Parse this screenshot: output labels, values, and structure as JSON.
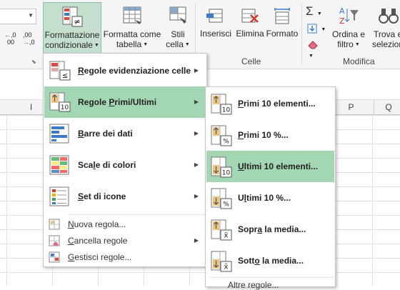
{
  "ribbon": {
    "number_format_value": "",
    "decimals_increase_label": ",0",
    "decimals_increase_sub": "00",
    "decimals_decrease_label": ",00",
    "decimals_decrease_sub": ",0",
    "conditional_formatting": {
      "line1": "Formattazione",
      "line2": "condizionale"
    },
    "format_as_table": {
      "line1": "Formatta come",
      "line2": "tabella"
    },
    "cell_styles": {
      "line1": "Stili",
      "line2": "cella"
    },
    "insert": {
      "line1": "Inserisci"
    },
    "delete": {
      "line1": "Elimina"
    },
    "format": {
      "line1": "Formato"
    },
    "sort_filter": {
      "line1": "Ordina e",
      "line2": "filtro"
    },
    "find_select": {
      "line1": "Trova e",
      "line2": "seleziona"
    },
    "groups": {
      "cells": "Celle",
      "editing": "Modifica"
    }
  },
  "columns": [
    "I",
    "P",
    "Q"
  ],
  "menu": {
    "items": [
      {
        "label_pre": "",
        "label_u": "R",
        "label_post": "egole evidenziazione celle",
        "icon": "highlight-rules-icon"
      },
      {
        "label_pre": "Regole ",
        "label_u": "P",
        "label_post": "rimi/Ultimi",
        "icon": "top-bottom-rules-icon"
      },
      {
        "label_pre": "",
        "label_u": "B",
        "label_post": "arre dei dati",
        "icon": "data-bars-icon"
      },
      {
        "label_pre": "Sca",
        "label_u": "l",
        "label_post": "e di colori",
        "icon": "color-scales-icon"
      },
      {
        "label_pre": "",
        "label_u": "S",
        "label_post": "et di icone",
        "icon": "icon-sets-icon"
      }
    ],
    "small_items": [
      {
        "label_pre": "",
        "label_u": "N",
        "label_post": "uova regola...",
        "icon": "new-rule-icon"
      },
      {
        "label_pre": "",
        "label_u": "C",
        "label_post": "ancella regole",
        "icon": "clear-rules-icon"
      },
      {
        "label_pre": "",
        "label_u": "G",
        "label_post": "estisci regole...",
        "icon": "manage-rules-icon"
      }
    ]
  },
  "submenu": {
    "items": [
      {
        "label_pre": "",
        "label_u": "P",
        "label_post": "rimi 10 elementi...",
        "icon": "top-10-items-icon",
        "badge": "10"
      },
      {
        "label_pre": "",
        "label_u": "P",
        "label_post": "rimi 10 %...",
        "icon": "top-10-percent-icon",
        "badge": "%"
      },
      {
        "label_pre": "",
        "label_u": "U",
        "label_post": "ltimi 10 elementi...",
        "icon": "bottom-10-items-icon",
        "badge": "10"
      },
      {
        "label_pre": "U",
        "label_u": "l",
        "label_post": "timi 10 %...",
        "icon": "bottom-10-percent-icon",
        "badge": "%"
      },
      {
        "label_pre": "Sopr",
        "label_u": "a",
        "label_post": " la media...",
        "icon": "above-average-icon",
        "badge": "x̄"
      },
      {
        "label_pre": "Sott",
        "label_u": "o",
        "label_post": " la media...",
        "icon": "below-average-icon",
        "badge": "x̄"
      }
    ],
    "more_rules": "Altre regole..."
  }
}
